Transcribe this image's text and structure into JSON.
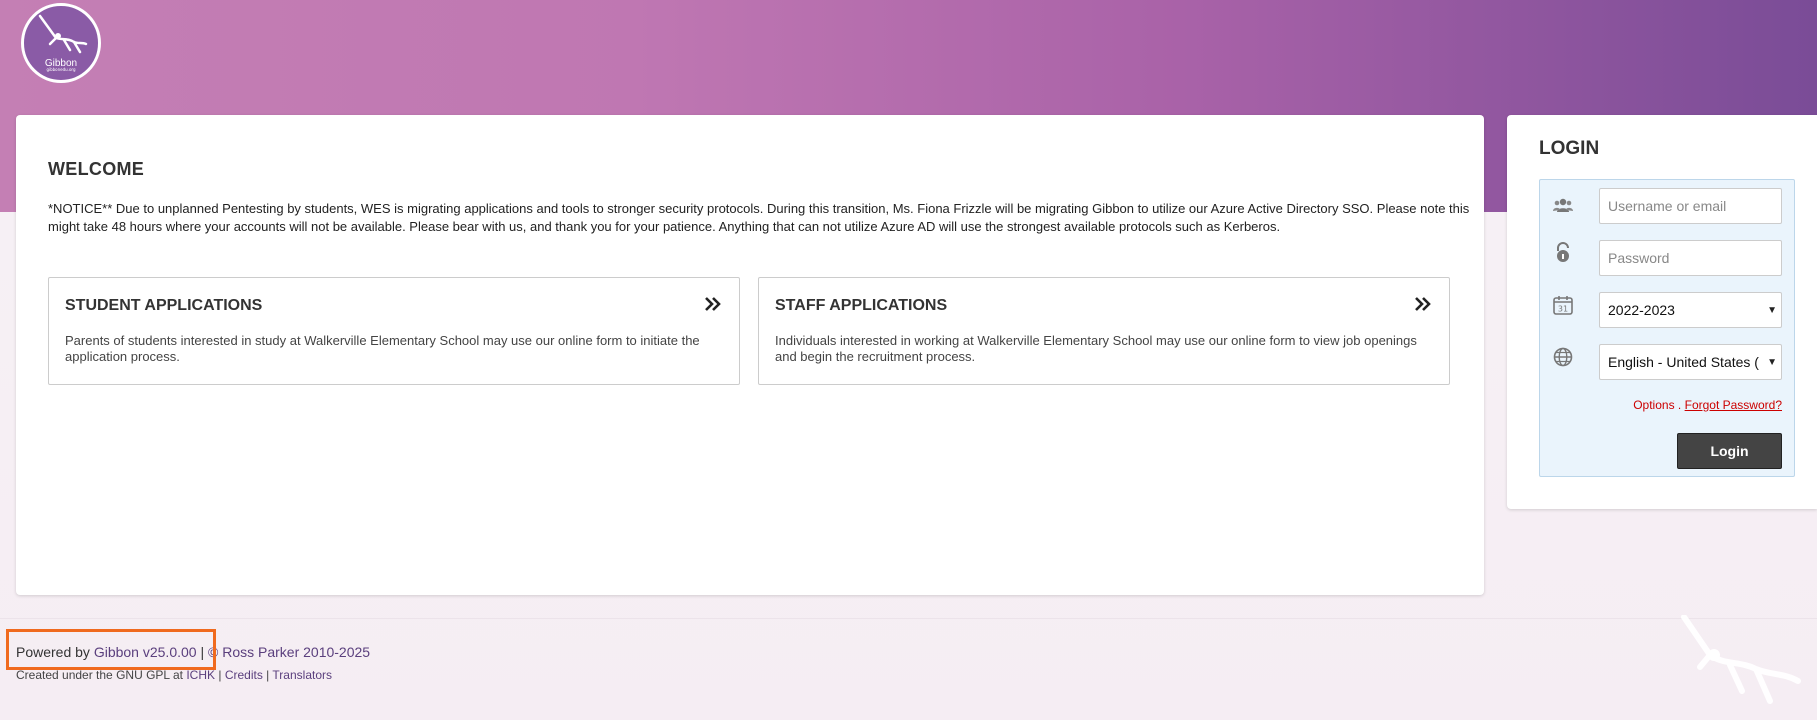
{
  "logo": {
    "name": "Gibbon",
    "subtext": "gibbonedu.org"
  },
  "welcome": {
    "title": "WELCOME",
    "notice": "*NOTICE** Due to unplanned Pentesting by students, WES is migrating applications and tools to stronger security protocols. During this transition, Ms. Fiona Frizzle will be migrating Gibbon to utilize our Azure Active Directory SSO. Please note this might take 48 hours where your accounts will not be available. Please bear with us, and thank you for your patience. Anything that can not utilize Azure AD will use the strongest available protocols such as Kerberos."
  },
  "applications": [
    {
      "title": "STUDENT APPLICATIONS",
      "description": "Parents of students interested in study at Walkerville Elementary School may use our online form to initiate the application process.",
      "icon": "double-chevron-right-icon"
    },
    {
      "title": "STAFF APPLICATIONS",
      "description": "Individuals interested in working at Walkerville Elementary School may use our online form to view job openings and begin the recruitment process.",
      "icon": "double-chevron-right-icon"
    }
  ],
  "login": {
    "title": "LOGIN",
    "username_placeholder": "Username or email",
    "password_placeholder": "Password",
    "school_year": "2022-2023",
    "language": "English - United States (",
    "options_label": "Options",
    "separator": ".",
    "forgot_label": "Forgot Password?",
    "button_label": "Login",
    "icons": [
      "users-icon",
      "lock-icon",
      "calendar-icon",
      "globe-icon"
    ]
  },
  "footer": {
    "powered_by": "Powered by",
    "gibbon_version": "Gibbon v25.0.00",
    "divider": "|",
    "copyright": "© Ross Parker 2010-2025",
    "created_text": "Created under the GNU GPL at",
    "ichk": "ICHK",
    "credits": "Credits",
    "translators": "Translators"
  },
  "colors": {
    "accent": "#8a5ba6",
    "highlight": "#f06a1e",
    "link_red": "#cc0000",
    "button": "#444444"
  }
}
